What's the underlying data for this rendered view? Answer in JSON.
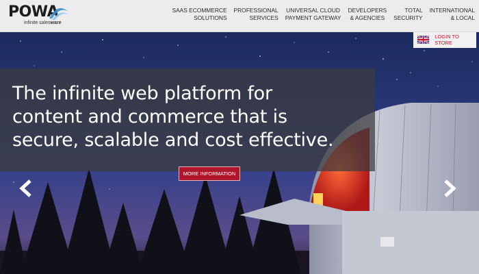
{
  "brand": {
    "name": "POWA",
    "tagline_prefix": "infinite sales",
    "tagline_bold": "ware"
  },
  "nav": {
    "items": [
      {
        "label": "SAAS ECOMMERCE\nSOLUTIONS"
      },
      {
        "label": "PROFESSIONAL\nSERVICES"
      },
      {
        "label": "UNIVERSAL CLOUD\nPAYMENT GATEWAY"
      },
      {
        "label": "DEVELOPERS\n& AGENCIES"
      },
      {
        "label": "TOTAL\nSECURITY"
      },
      {
        "label": "INTERNATIONAL\n& LOCAL"
      }
    ]
  },
  "login": {
    "label": "LOGIN TO STORE",
    "flag_icon": "uk-flag-icon"
  },
  "hero": {
    "headline_lines": [
      "The infinite web platform for",
      "content and commerce that is",
      "secure, scalable and cost effective."
    ],
    "cta_label": "MORE INFORMATION",
    "prev_icon": "chevron-left-icon",
    "next_icon": "chevron-right-icon"
  },
  "colors": {
    "accent": "#b0162b",
    "header_bg": "#ececec",
    "banner_bg": "#3c3c3c",
    "logo_swoosh": "#3a8fd1"
  }
}
